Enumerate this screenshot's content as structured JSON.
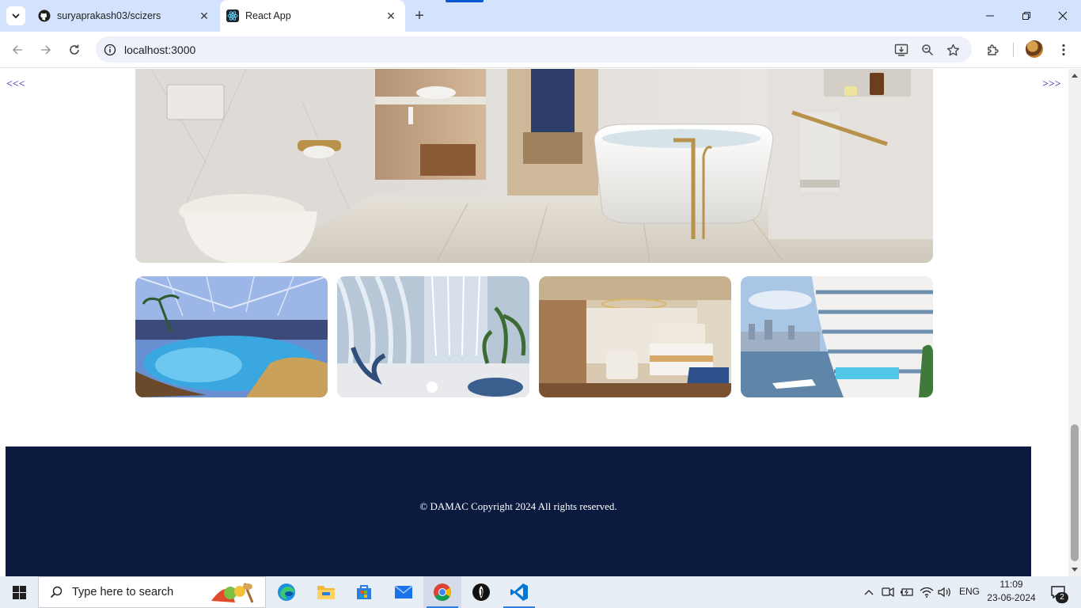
{
  "browser": {
    "tabs": [
      {
        "title": "suryaprakash03/scizers",
        "icon": "github-icon",
        "active": false
      },
      {
        "title": "React App",
        "icon": "react-icon",
        "active": true
      }
    ],
    "close_glyph": "✕",
    "new_tab_glyph": "+",
    "address": "localhost:3000"
  },
  "page": {
    "prev_link": "<<<",
    "next_link": ">>>",
    "hero_image": "bathroom-with-freestanding-tub",
    "thumbnails": [
      {
        "name": "indoor-pool-thumbnail"
      },
      {
        "name": "lobby-waterfall-thumbnail"
      },
      {
        "name": "hotel-bedroom-thumbnail"
      },
      {
        "name": "waterfront-tower-thumbnail"
      }
    ],
    "footer_text": "© DAMAC Copyright 2024 All rights reserved."
  },
  "taskbar": {
    "search_placeholder": "Type here to search",
    "language": "ENG",
    "time": "11:09",
    "date": "23-06-2024",
    "notification_count": "2",
    "apps": [
      "edge-icon",
      "file-explorer-icon",
      "store-icon",
      "mail-icon",
      "chrome-icon",
      "maps-icon",
      "vscode-icon"
    ]
  },
  "colors": {
    "tab_strip": "#d3e3fd",
    "footer_bg": "#0b1b3f",
    "link": "#1a0dab",
    "taskbar": "#e8eef6"
  }
}
